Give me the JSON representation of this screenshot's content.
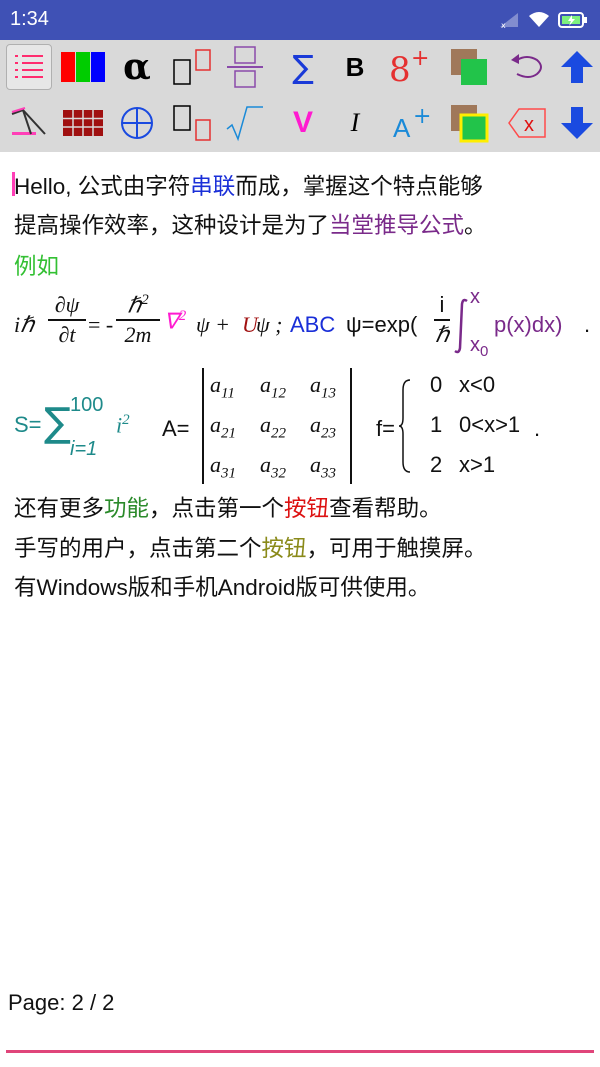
{
  "status": {
    "time": "1:34"
  },
  "toolbar": {
    "row1": [
      "list-icon",
      "color-bars-icon",
      "alpha-icon",
      "subscript-box-icon",
      "fraction-icon",
      "sigma-icon",
      "bold-icon",
      "google-plus-icon",
      "bg-color-icon",
      "undo-icon",
      "arrow-up-icon"
    ],
    "row2": [
      "slash-tool-icon",
      "brick-wall-icon",
      "circle-plus-icon",
      "box-sub-icon",
      "sqrt-icon",
      "vector-icon",
      "italic-icon",
      "font-size-icon",
      "fg-color-icon",
      "delete-icon",
      "arrow-down-icon"
    ],
    "bold_label": "B",
    "italic_label": "I",
    "vector_label": "V",
    "alpha_label": "α",
    "sigma_label": "∑"
  },
  "content": {
    "line1_a": "Hello, 公式由字符",
    "line1_b": "串联",
    "line1_c": "而成，掌握这个特点能够",
    "line2_a": "提高操作效率，这种设计是为了",
    "line2_b": "当堂推导公式",
    "line2_c": "。",
    "line3": "例如",
    "eq1": {
      "i_hbar": "iℏ",
      "dpsi": "∂ψ",
      "dt": "∂t",
      "eq_minus": "= -",
      "hbar2": "ℏ",
      "sup2": "2",
      "two_m": "2m",
      "nabla": "∇",
      "psi_plus": "ψ +",
      "U": "U",
      "psi_semicolon": "ψ ;",
      "abc": "ABC",
      "psi_exp": "ψ=exp(",
      "i_num": "i",
      "hbar_den": "ℏ",
      "int_upper": "x",
      "int_lower": "x",
      "int_lower_sub": "0",
      "p_tail": "p(x)dx)",
      "period": "."
    },
    "eq2": {
      "s_eq": "S=",
      "sum_upper": "100",
      "sum_lower": "i=1",
      "i_sq": "i",
      "i_sup": "2",
      "a_eq": "A=",
      "matrix": [
        [
          "a11",
          "a12",
          "a13"
        ],
        [
          "a21",
          "a22",
          "a23"
        ],
        [
          "a31",
          "a32",
          "a33"
        ]
      ],
      "f_eq": "f=",
      "cases": [
        [
          "0",
          "x<0"
        ],
        [
          "1",
          "0<x>1"
        ],
        [
          "2",
          "x>1"
        ]
      ],
      "dot": "."
    },
    "line4_a": "还有更多",
    "line4_b": "功能",
    "line4_c": "，点击第一个",
    "line4_d": "按钮",
    "line4_e": "查看帮助。",
    "line5_a": "手写的用户，点击第二个",
    "line5_b": "按钮",
    "line5_c": "，可用于触摸屏。",
    "line6": "有Windows版和手机Android版可供使用。"
  },
  "footer": {
    "page": "Page: 2 / 2"
  },
  "colors": {
    "accent": "#3F51B5",
    "pink": "#ff3fb7",
    "toolbar_bg": "#d9d9d9"
  }
}
